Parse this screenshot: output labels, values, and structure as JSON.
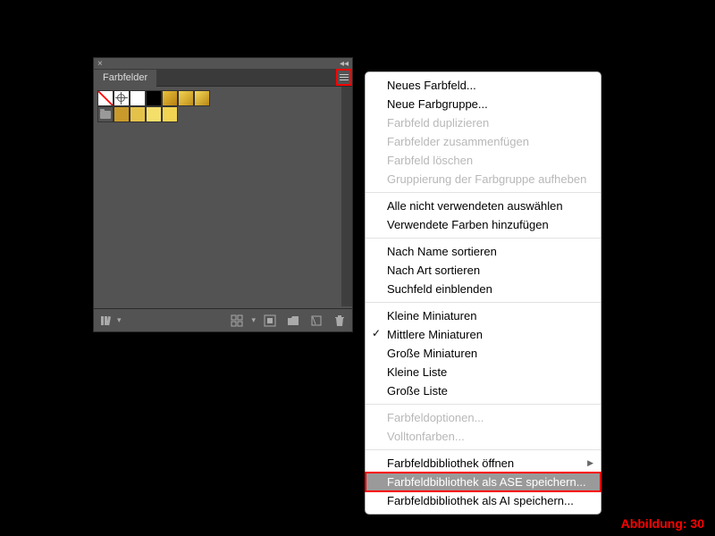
{
  "panel": {
    "tab_title": "Farbfelder",
    "swatches_row1": [
      {
        "kind": "none"
      },
      {
        "kind": "registration"
      },
      {
        "kind": "color",
        "color": "#ffffff"
      },
      {
        "kind": "color",
        "color": "#000000"
      },
      {
        "kind": "gradient",
        "colors": [
          "#e9c23a",
          "#b88012"
        ]
      },
      {
        "kind": "gradient",
        "colors": [
          "#f2d452",
          "#c08f1a"
        ]
      },
      {
        "kind": "gradient",
        "colors": [
          "#f6da5c",
          "#b98714"
        ]
      }
    ],
    "swatches_row2": [
      {
        "kind": "folder"
      },
      {
        "kind": "color",
        "color": "#c99a2b"
      },
      {
        "kind": "color",
        "color": "#e4c24a"
      },
      {
        "kind": "color",
        "color": "#f5df6b"
      },
      {
        "kind": "color",
        "color": "#f2d452"
      }
    ]
  },
  "footer_icons": {
    "library_menu": "library-menu-icon",
    "grid": "grid-view-icon",
    "options": "swatch-options-icon",
    "colorgroup": "new-colorgroup-icon",
    "newswatch": "new-swatch-icon",
    "trash": "delete-icon"
  },
  "menu": [
    {
      "type": "item",
      "label": "Neues Farbfeld...",
      "enabled": true
    },
    {
      "type": "item",
      "label": "Neue Farbgruppe...",
      "enabled": true
    },
    {
      "type": "item",
      "label": "Farbfeld duplizieren",
      "enabled": false
    },
    {
      "type": "item",
      "label": "Farbfelder zusammenfügen",
      "enabled": false
    },
    {
      "type": "item",
      "label": "Farbfeld löschen",
      "enabled": false
    },
    {
      "type": "item",
      "label": "Gruppierung der Farbgruppe aufheben",
      "enabled": false
    },
    {
      "type": "sep"
    },
    {
      "type": "item",
      "label": "Alle nicht verwendeten auswählen",
      "enabled": true
    },
    {
      "type": "item",
      "label": "Verwendete Farben hinzufügen",
      "enabled": true
    },
    {
      "type": "sep"
    },
    {
      "type": "item",
      "label": "Nach Name sortieren",
      "enabled": true
    },
    {
      "type": "item",
      "label": "Nach Art sortieren",
      "enabled": true
    },
    {
      "type": "item",
      "label": "Suchfeld einblenden",
      "enabled": true
    },
    {
      "type": "sep"
    },
    {
      "type": "item",
      "label": "Kleine Miniaturen",
      "enabled": true
    },
    {
      "type": "item",
      "label": "Mittlere Miniaturen",
      "enabled": true,
      "checked": true
    },
    {
      "type": "item",
      "label": "Große Miniaturen",
      "enabled": true
    },
    {
      "type": "item",
      "label": "Kleine Liste",
      "enabled": true
    },
    {
      "type": "item",
      "label": "Große Liste",
      "enabled": true
    },
    {
      "type": "sep"
    },
    {
      "type": "item",
      "label": "Farbfeldoptionen...",
      "enabled": false
    },
    {
      "type": "item",
      "label": "Volltonfarben...",
      "enabled": false
    },
    {
      "type": "sep"
    },
    {
      "type": "item",
      "label": "Farbfeldbibliothek öffnen",
      "enabled": true,
      "submenu": true
    },
    {
      "type": "item",
      "label": "Farbfeldbibliothek als ASE speichern...",
      "enabled": true,
      "highlight": true
    },
    {
      "type": "item",
      "label": "Farbfeldbibliothek als AI speichern...",
      "enabled": true
    }
  ],
  "figure_label": "Abbildung: 30"
}
